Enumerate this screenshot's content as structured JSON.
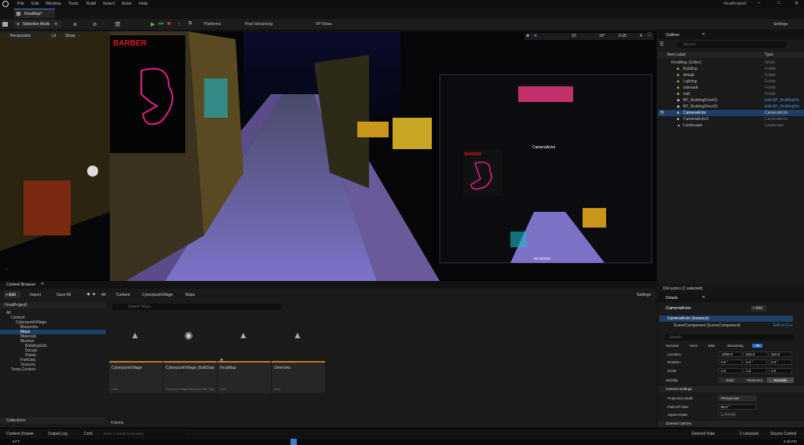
{
  "menubar": {
    "items": [
      "File",
      "Edit",
      "Window",
      "Tools",
      "Build",
      "Select",
      "Actor",
      "Help"
    ],
    "project_title": "FinalProject1"
  },
  "tabbar": {
    "active_tab": "FinalMap*"
  },
  "toolbar": {
    "selection_mode": "Selection Mode",
    "platforms": "Platforms",
    "pixel_streaming": "Pixel Streaming",
    "vp_roles": "VP Roles",
    "settings": "Settings"
  },
  "viewport": {
    "perspective": "Perspective",
    "lit": "Lit",
    "show": "Show",
    "grid_snap": "10",
    "rot_snap": "10°",
    "scale_snap": "0.25",
    "cam_speed": "4",
    "camera_label": "CameraActor",
    "pip_readout": "90.000000"
  },
  "outliner": {
    "title": "Outliner",
    "search_placeholder": "Search",
    "col_label": "Item Label",
    "col_type": "Type",
    "items": [
      {
        "label": "FinalMap (Editor)",
        "type": "World"
      },
      {
        "label": "Building",
        "type": "Folder"
      },
      {
        "label": "details",
        "type": "Folder"
      },
      {
        "label": "Lighting",
        "type": "Folder"
      },
      {
        "label": "sidewalk",
        "type": "Folder"
      },
      {
        "label": "wall",
        "type": "Folder"
      },
      {
        "label": "BP_BuildingFloor01",
        "type": "Edit BP_BuildingFlo"
      },
      {
        "label": "BP_BuildingFloor02",
        "type": "Edit BP_BuildingFlo"
      },
      {
        "label": "CameraActor",
        "type": "CameraActor"
      },
      {
        "label": "CameraActor2",
        "type": "CameraActor"
      },
      {
        "label": "Landscape",
        "type": "Landscape"
      }
    ],
    "footer": "154 actors (1 selected)"
  },
  "details": {
    "title": "Details",
    "actor": "CameraActor",
    "add": "+ Add",
    "instance": "CameraActor (Instance)",
    "component": "SceneComponent (SceneComponent)",
    "edit_cpp": "Edit in C++",
    "search_placeholder": "Search",
    "tabs": [
      "General",
      "Actor",
      "Misc",
      "Streaming",
      "All"
    ],
    "location_label": "Location",
    "location": [
      "-1000.0",
      "520.0",
      "310.0"
    ],
    "rotation_label": "Rotation",
    "rotation": [
      "0.0 °",
      "0.0 °",
      "0.0 °"
    ],
    "scale_label": "Scale",
    "scale": [
      "1.0",
      "1.0",
      "1.0"
    ],
    "mobility_label": "Mobility",
    "mobility": [
      "Static",
      "Stationary",
      "Movable"
    ],
    "camera_settings": "Camera Settings",
    "proj_mode_label": "Projection Mode",
    "proj_mode": "Perspective",
    "fov_label": "Field Of View",
    "fov": "90.0 °",
    "aspect_label": "Aspect Ratio",
    "aspect": "1.777778",
    "camera_options": "Camera Options"
  },
  "content": {
    "title": "Content Browser",
    "add": "+ Add",
    "import": "Import",
    "save_all": "Save All",
    "path": [
      "All",
      "Content",
      "CyberpunkVillage",
      "Maps"
    ],
    "settings": "Settings",
    "project": "FinalProject1",
    "search_placeholder": "Search Maps",
    "tree": [
      "All",
      "Content",
      "CyberpunkVillage",
      "Blueprints",
      "Maps",
      "Materials",
      "Meshes",
      "BuildingSets",
      "Decals",
      "Plants",
      "Particles",
      "Textures",
      "Temp Content"
    ],
    "assets": [
      {
        "name": "CyberpunkVillage",
        "type": "Level"
      },
      {
        "name": "CyberpunkVillage_BuiltData",
        "type": "Cyberpunk Village Map Build Data Registry"
      },
      {
        "name": "FinalMap",
        "type": "Level"
      },
      {
        "name": "Overview",
        "type": "Level"
      }
    ],
    "count": "4 items",
    "collections": "Collections"
  },
  "statusbar": {
    "drawer": "Content Drawer",
    "log": "Output Log",
    "cmd": "Cmd",
    "cmd_placeholder": "Enter Console Command",
    "derived": "Derived Data",
    "unsaved": "1 Unsaved",
    "source": "Source Control"
  },
  "taskbar": {
    "weather": "54°F",
    "time": "2:48 PM"
  }
}
